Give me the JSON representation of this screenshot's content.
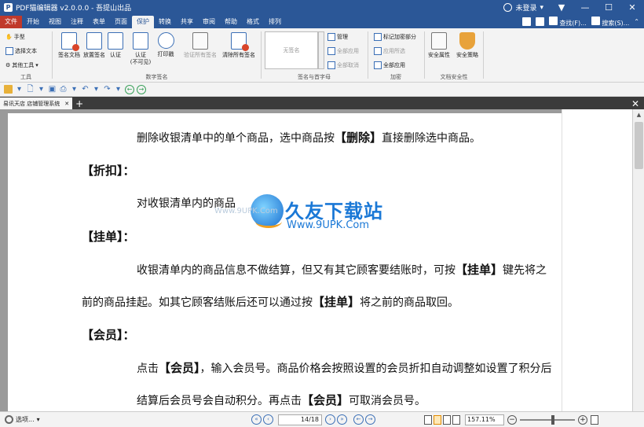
{
  "window": {
    "title": "PDF猫编辑器 v2.0.0.0 - 吾提山出品",
    "login": "未登录"
  },
  "tabs": [
    "文件",
    "开始",
    "视图",
    "注释",
    "表单",
    "页面",
    "保护",
    "转换",
    "共享",
    "审阅",
    "帮助",
    "格式",
    "排列"
  ],
  "active_tab": "保护",
  "tab_right": {
    "find": "查找(F)...",
    "search": "搜索(S)..."
  },
  "ribbon": {
    "tools": {
      "label": "工具",
      "hand": "手型",
      "select_text": "选择文本",
      "other_tools": "其他工具"
    },
    "digital_signature": {
      "label": "数字签名",
      "sign_doc": "签名文档",
      "place_sig": "放置签名",
      "verify": "认证",
      "verify_invisible": "认证\n(不可见)",
      "print_timestamp": "打印戳",
      "verify_all": "验证所有签名",
      "clear_all": "清除所有签名"
    },
    "signature_initials": {
      "label": "签名与首字母",
      "no_signature": "无签名",
      "manage": "管理",
      "apply_all": "全部应用",
      "cancel_all": "全部取消"
    },
    "redaction": {
      "label": "加密",
      "mark": "标记加密部分",
      "apply_selected": "应用所选",
      "apply_all": "全部应用"
    },
    "doc_security": {
      "label": "文档安全性",
      "security_props": "安全属性",
      "security_policy": "安全策略"
    }
  },
  "doc_tab": "易讯天店 店铺管理系统",
  "document": {
    "p1": "删除收银清单中的单个商品，选中商品按",
    "p1_key": "【删除】",
    "p1_end": "直接删除选中商品。",
    "h_discount": "【折扣】：",
    "p2": "对收银清单内的商品",
    "h_hold": "【挂单】：",
    "p3": "收银清单内的商品信息不做结算，但又有其它顾客要结账时，可按",
    "p3_key": "【挂单】",
    "p3_end": "键先将之",
    "p4": "前的商品挂起。如其它顾客结账后还可以通过按",
    "p4_key": "【挂单】",
    "p4_end": "将之前的商品取回。",
    "h_member": "【会员】：",
    "p5": "点击",
    "p5_key": "【会员】",
    "p5_end": "，输入会员号。商品价格会按照设置的会员折扣自动调整如设置了积分后",
    "p6": "结算后会员号会自动积分。再点击",
    "p6_key": "【会员】",
    "p6_end": "可取消会员号。"
  },
  "watermark": {
    "title": "久友下载站",
    "url": "Www.9UPK.Com",
    "faint": "Www.9UPK.Com"
  },
  "statusbar": {
    "options": "选项...",
    "page": "14/18",
    "zoom": "157.11%"
  }
}
